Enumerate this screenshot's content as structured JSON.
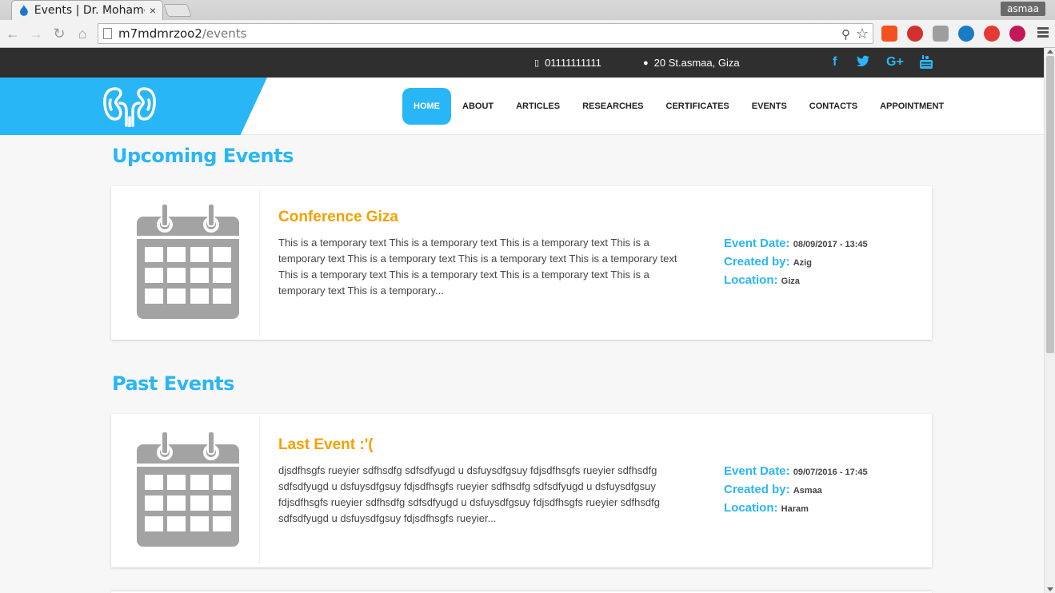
{
  "browser": {
    "tab_title": "Events | Dr. Mohame",
    "tab_close": "×",
    "profile_name": "asmaa",
    "url_host": "m7mdmrzoo2",
    "url_path": "/events"
  },
  "topbar": {
    "phone": "01111111111",
    "address": "20 St.asmaa, Giza",
    "social": [
      "f",
      "t",
      "G+",
      "yt"
    ]
  },
  "nav": {
    "items": [
      "HOME",
      "ABOUT",
      "ARTICLES",
      "RESEARCHES",
      "CERTIFICATES",
      "EVENTS",
      "CONTACTS",
      "APPOINTMENT"
    ],
    "active": "HOME"
  },
  "upcoming": {
    "heading": "Upcoming Events",
    "events": [
      {
        "title": "Conference Giza",
        "description": "This is a temporary text This is a temporary text This is a temporary text This is a temporary text This is a temporary text This is a temporary text This is a temporary text This is a temporary text This is a temporary text This is a temporary text This is a temporary text This is a temporary...",
        "date_label": "Event Date:",
        "date": "08/09/2017 - 13:45",
        "created_label": "Created by:",
        "created_by": "Azig",
        "location_label": "Location:",
        "location": "Giza"
      }
    ]
  },
  "past": {
    "heading": "Past Events",
    "events": [
      {
        "title": "Last Event :'(",
        "description": "djsdfhsgfs rueyier sdfhsdfg sdfsdfyugd u dsfuysdfgsuy fdjsdfhsgfs rueyier sdfhsdfg sdfsdfyugd u dsfuysdfgsuy fdjsdfhsgfs rueyier sdfhsdfg sdfsdfyugd u dsfuysdfgsuy fdjsdfhsgfs rueyier sdfhsdfg sdfsdfyugd u dsfuysdfgsuy fdjsdfhsgfs rueyier sdfhsdfg sdfsdfyugd u dsfuysdfgsuy fdjsdfhsgfs rueyier...",
        "date_label": "Event Date:",
        "date": "09/07/2016 - 17:45",
        "created_label": "Created by:",
        "created_by": "Asmaa",
        "location_label": "Location:",
        "location": "Haram"
      }
    ]
  },
  "colors": {
    "accent": "#29b6f6",
    "title_orange": "#f5a000",
    "topbar": "#2f2f2f"
  }
}
